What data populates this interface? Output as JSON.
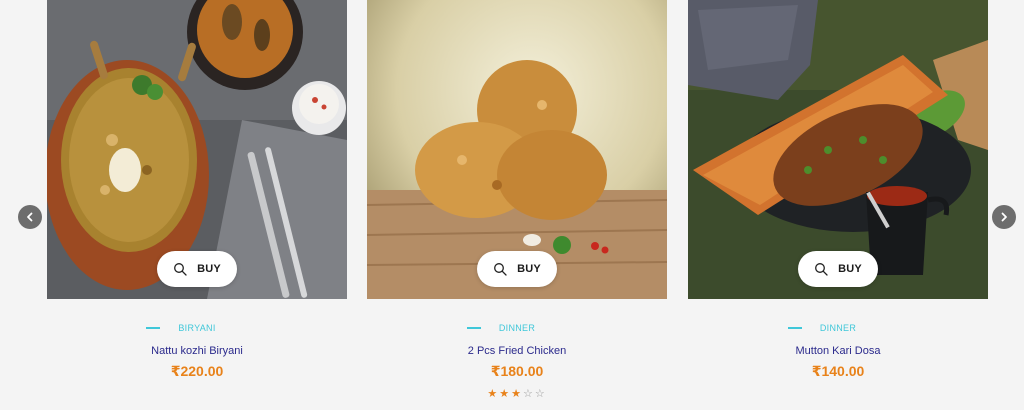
{
  "carousel": {
    "prev_icon": "chevron-left-icon",
    "next_icon": "chevron-right-icon",
    "accent_color": "#3fc7d9",
    "title_color": "#2b2a8c",
    "price_color": "#e8821a",
    "products": [
      {
        "image": "biryani-clay-pot-photo",
        "buy_label": "BUY",
        "buy_icon": "search-icon",
        "category": "BIRYANI",
        "title": "Nattu kozhi Biryani",
        "price": "₹220.00",
        "rating": null
      },
      {
        "image": "fried-chicken-photo",
        "buy_label": "BUY",
        "buy_icon": "search-icon",
        "category": "DINNER",
        "title": "2 Pcs Fried Chicken",
        "price": "₹180.00",
        "rating": 3
      },
      {
        "image": "dosa-photo",
        "buy_label": "BUY",
        "buy_icon": "search-icon",
        "category": "DINNER",
        "title": "Mutton Kari Dosa",
        "price": "₹140.00",
        "rating": null
      }
    ]
  }
}
